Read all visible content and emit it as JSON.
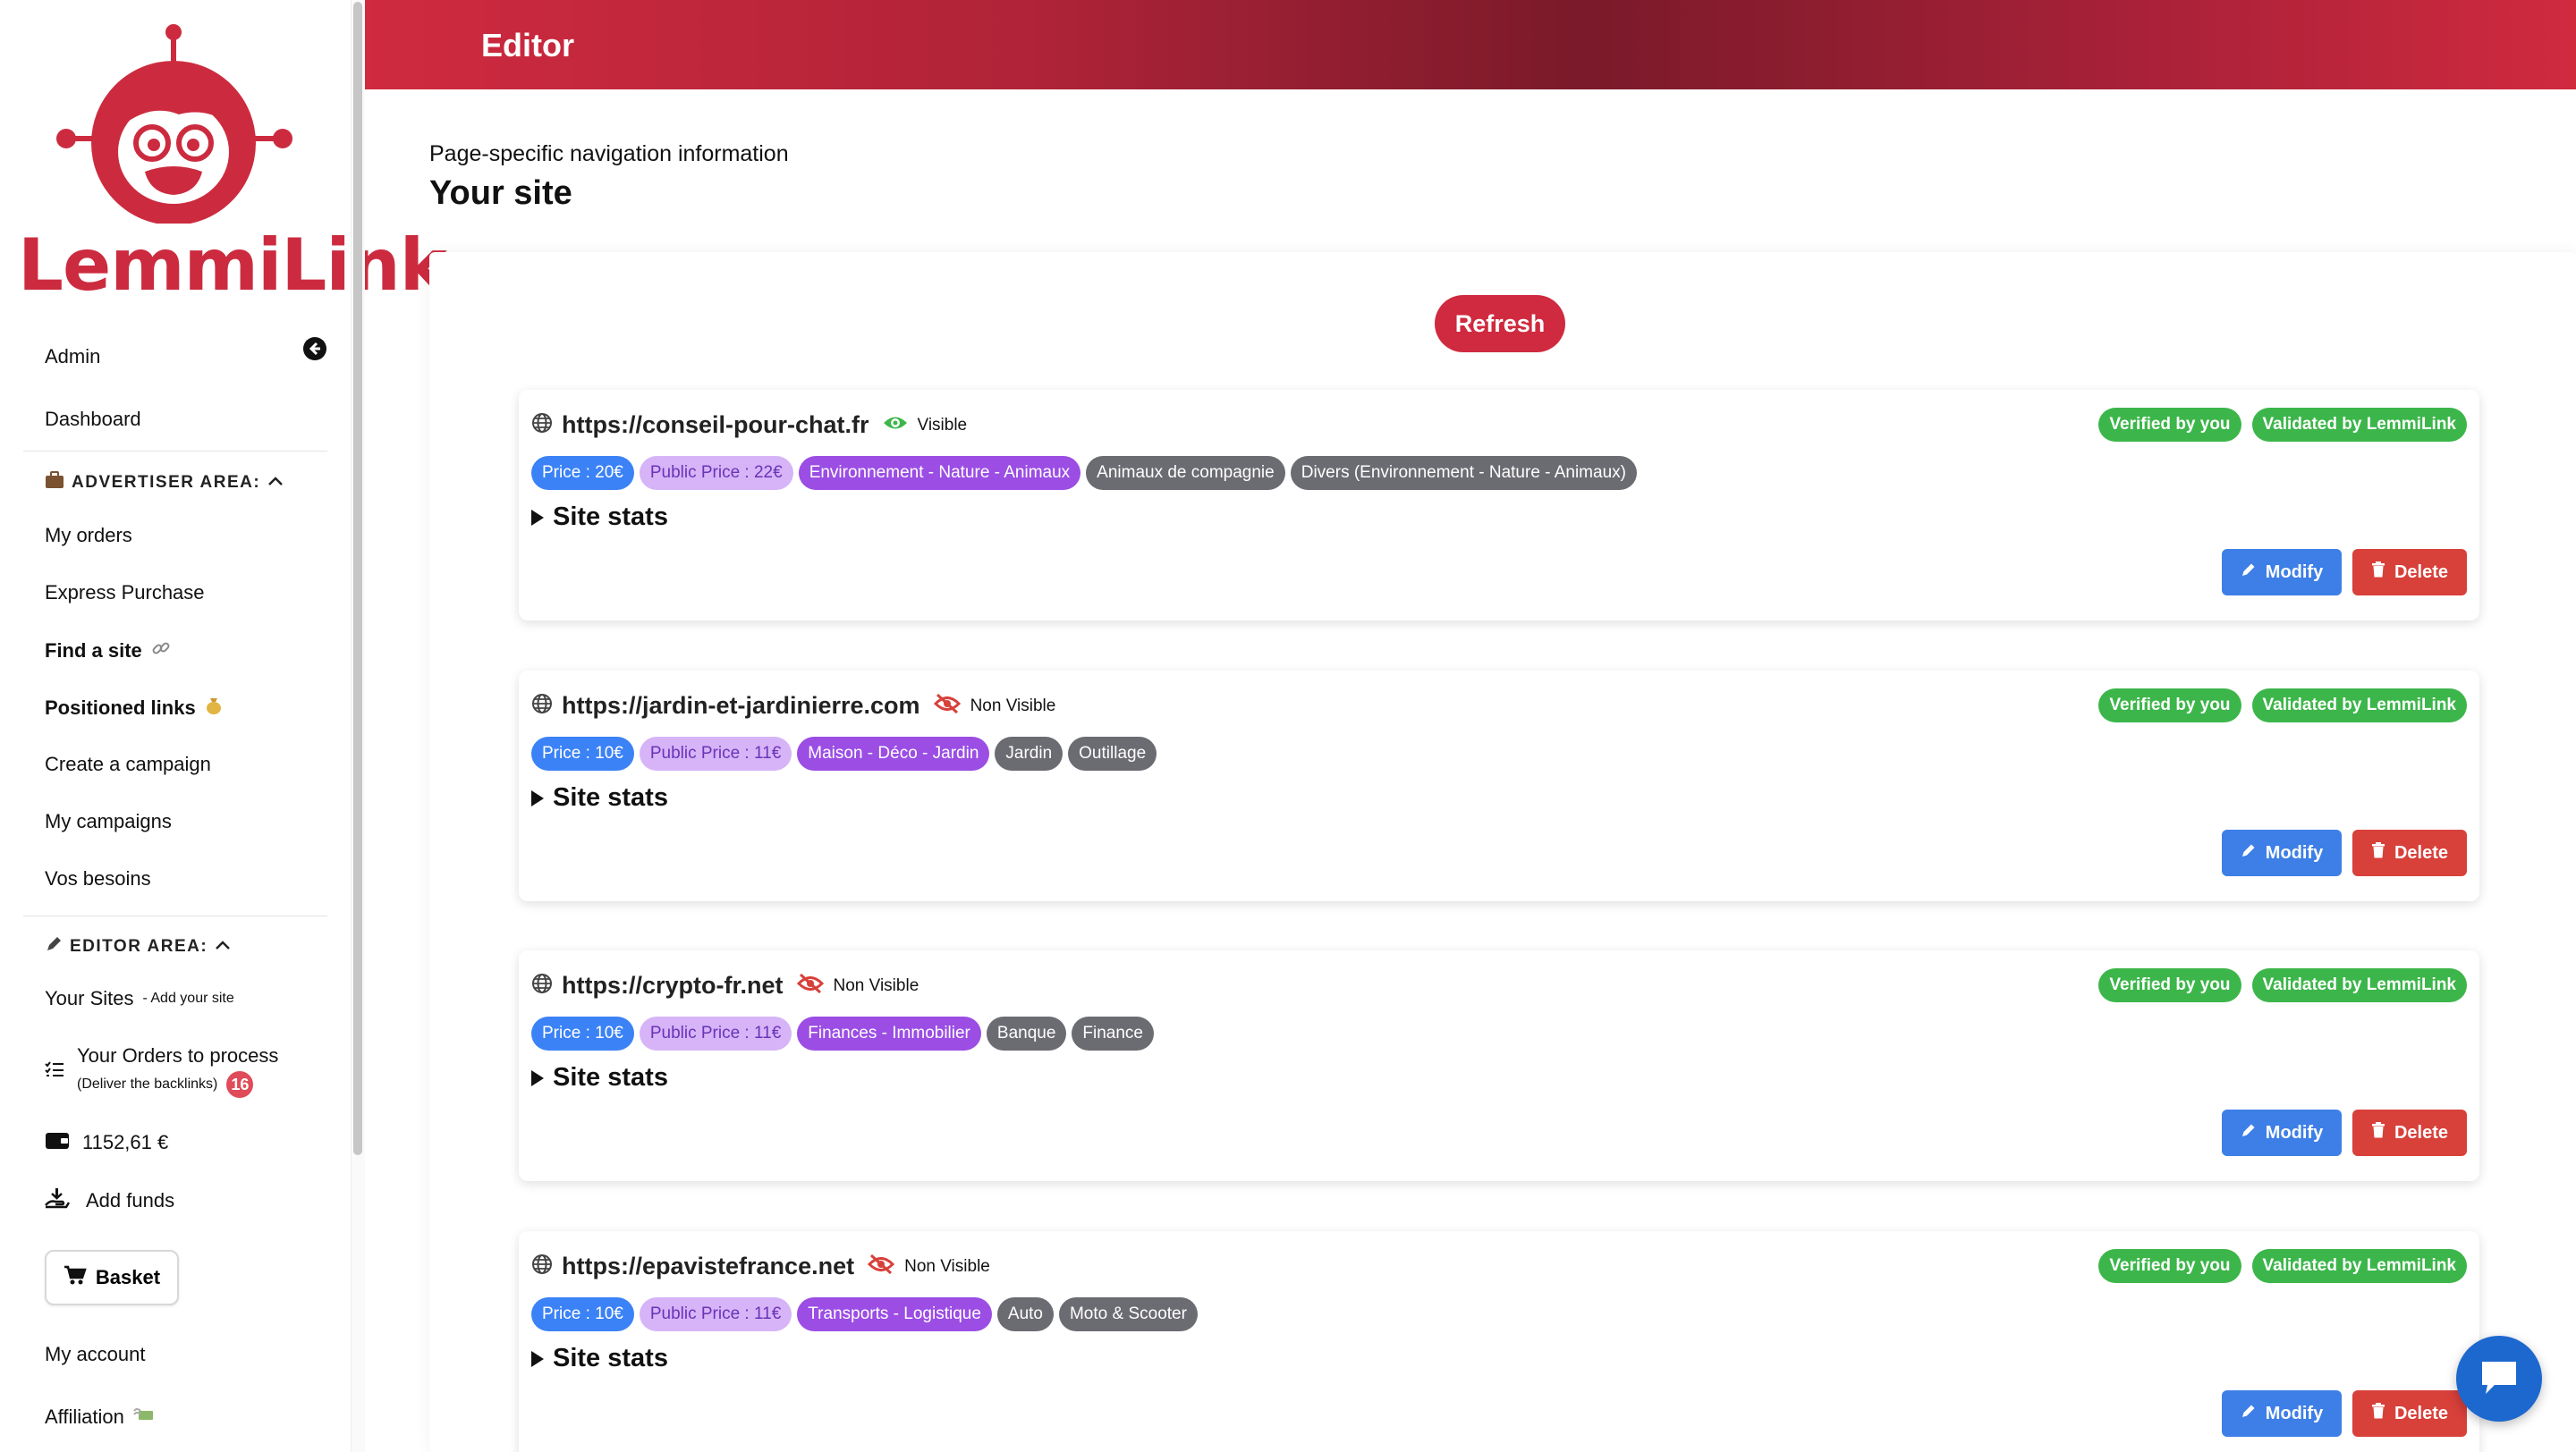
{
  "brand": {
    "name": "LemmiLink",
    "color": "#cc2b3f"
  },
  "sidebar": {
    "admin_label": "Admin",
    "dashboard_label": "Dashboard",
    "advertiser_title": "ADVERTISER AREA:",
    "advertiser_items": [
      "My orders",
      "Express Purchase",
      "Find a site",
      "Positioned links",
      "Create a campaign",
      "My campaigns",
      "Vos besoins"
    ],
    "editor_title": "EDITOR AREA:",
    "your_sites_label": "Your Sites",
    "add_site_label": "- Add your site",
    "orders_label": "Your Orders to process",
    "orders_note": "(Deliver the backlinks)",
    "orders_count": "16",
    "balance": "1152,61 €",
    "add_funds_label": "Add funds",
    "basket_label": "Basket",
    "my_account_label": "My account",
    "affiliation_label": "Affiliation"
  },
  "header": {
    "title": "Editor"
  },
  "main": {
    "breadcrumb": "Page-specific navigation information",
    "title": "Your site",
    "refresh_label": "Refresh"
  },
  "sites": [
    {
      "url": "https://conseil-pour-chat.fr",
      "visibility": "Visible",
      "visible": true,
      "price": "Price : 20€",
      "public_price": "Public Price : 22€",
      "category": "Environnement - Nature - Animaux",
      "subcategories": [
        "Animaux de compagnie",
        "Divers (Environnement - Nature - Animaux)"
      ],
      "stats_label": "Site stats",
      "verified_label": "Verified by you",
      "validated_label": "Validated by LemmiLink",
      "modify_label": "Modify",
      "delete_label": "Delete"
    },
    {
      "url": "https://jardin-et-jardinierre.com",
      "visibility": "Non Visible",
      "visible": false,
      "price": "Price : 10€",
      "public_price": "Public Price : 11€",
      "category": "Maison - Déco - Jardin",
      "subcategories": [
        "Jardin",
        "Outillage"
      ],
      "stats_label": "Site stats",
      "verified_label": "Verified by you",
      "validated_label": "Validated by LemmiLink",
      "modify_label": "Modify",
      "delete_label": "Delete"
    },
    {
      "url": "https://crypto-fr.net",
      "visibility": "Non Visible",
      "visible": false,
      "price": "Price : 10€",
      "public_price": "Public Price : 11€",
      "category": "Finances - Immobilier",
      "subcategories": [
        "Banque",
        "Finance"
      ],
      "stats_label": "Site stats",
      "verified_label": "Verified by you",
      "validated_label": "Validated by LemmiLink",
      "modify_label": "Modify",
      "delete_label": "Delete"
    },
    {
      "url": "https://epavistefrance.net",
      "visibility": "Non Visible",
      "visible": false,
      "price": "Price : 10€",
      "public_price": "Public Price : 11€",
      "category": "Transports - Logistique",
      "subcategories": [
        "Auto",
        "Moto & Scooter"
      ],
      "stats_label": "Site stats",
      "verified_label": "Verified by you",
      "validated_label": "Validated by LemmiLink",
      "modify_label": "Modify",
      "delete_label": "Delete"
    }
  ],
  "icons": {
    "collapse": "arrow-left-circle-icon",
    "visible": "eye-icon",
    "non_visible": "eye-slash-icon",
    "globe": "globe-icon",
    "chat": "chat-icon"
  }
}
